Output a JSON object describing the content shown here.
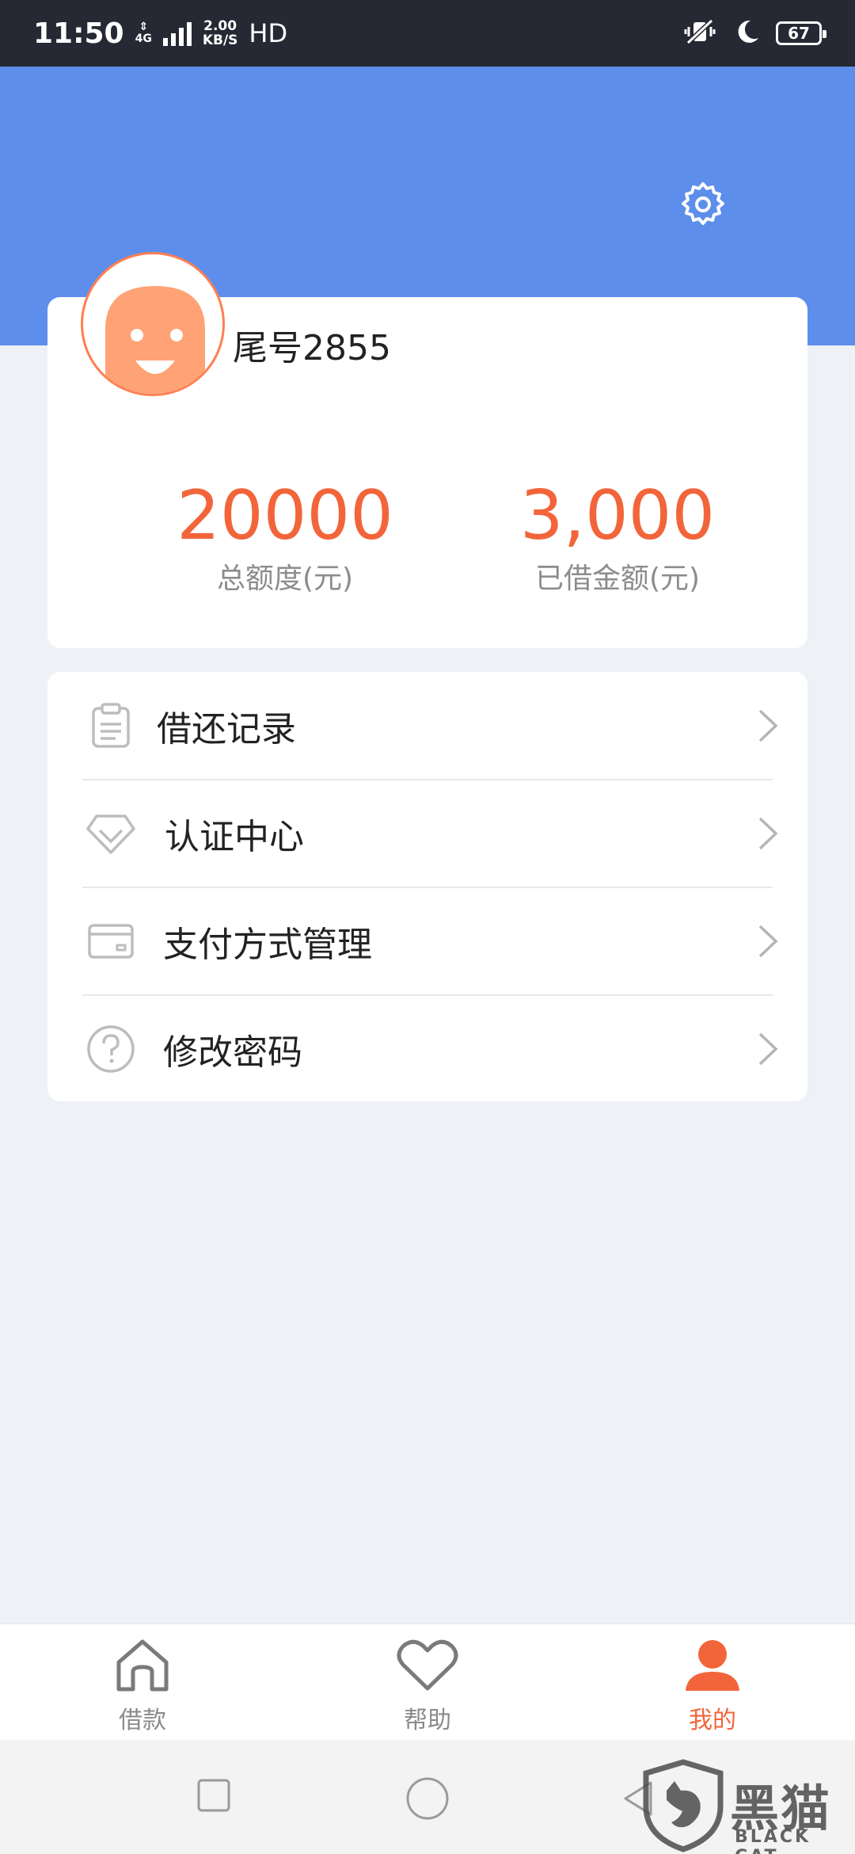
{
  "status_bar": {
    "time": "11:50",
    "network": "4G",
    "speed_value": "2.00",
    "speed_unit": "KB/S",
    "hd": "HD",
    "battery": "67"
  },
  "profile": {
    "username": "尾号2855",
    "total_limit_value": "20000",
    "total_limit_label": "总额度(元)",
    "borrowed_value": "3,000",
    "borrowed_label": "已借金额(元)"
  },
  "menu": {
    "items": [
      {
        "label": "借还记录",
        "icon": "clipboard-icon"
      },
      {
        "label": "认证中心",
        "icon": "diamond-icon"
      },
      {
        "label": "支付方式管理",
        "icon": "card-icon"
      },
      {
        "label": "修改密码",
        "icon": "question-icon"
      }
    ]
  },
  "bottom_nav": {
    "items": [
      {
        "label": "借款",
        "icon": "home-icon",
        "active": false
      },
      {
        "label": "帮助",
        "icon": "heart-icon",
        "active": false
      },
      {
        "label": "我的",
        "icon": "person-icon",
        "active": true
      }
    ]
  },
  "watermark": {
    "title": "黑猫",
    "subtitle": "BLACK CAT"
  },
  "colors": {
    "header_blue": "#5e8eeb",
    "accent_orange": "#f2653a",
    "status_bar": "#262833",
    "background": "#eef1f5"
  }
}
